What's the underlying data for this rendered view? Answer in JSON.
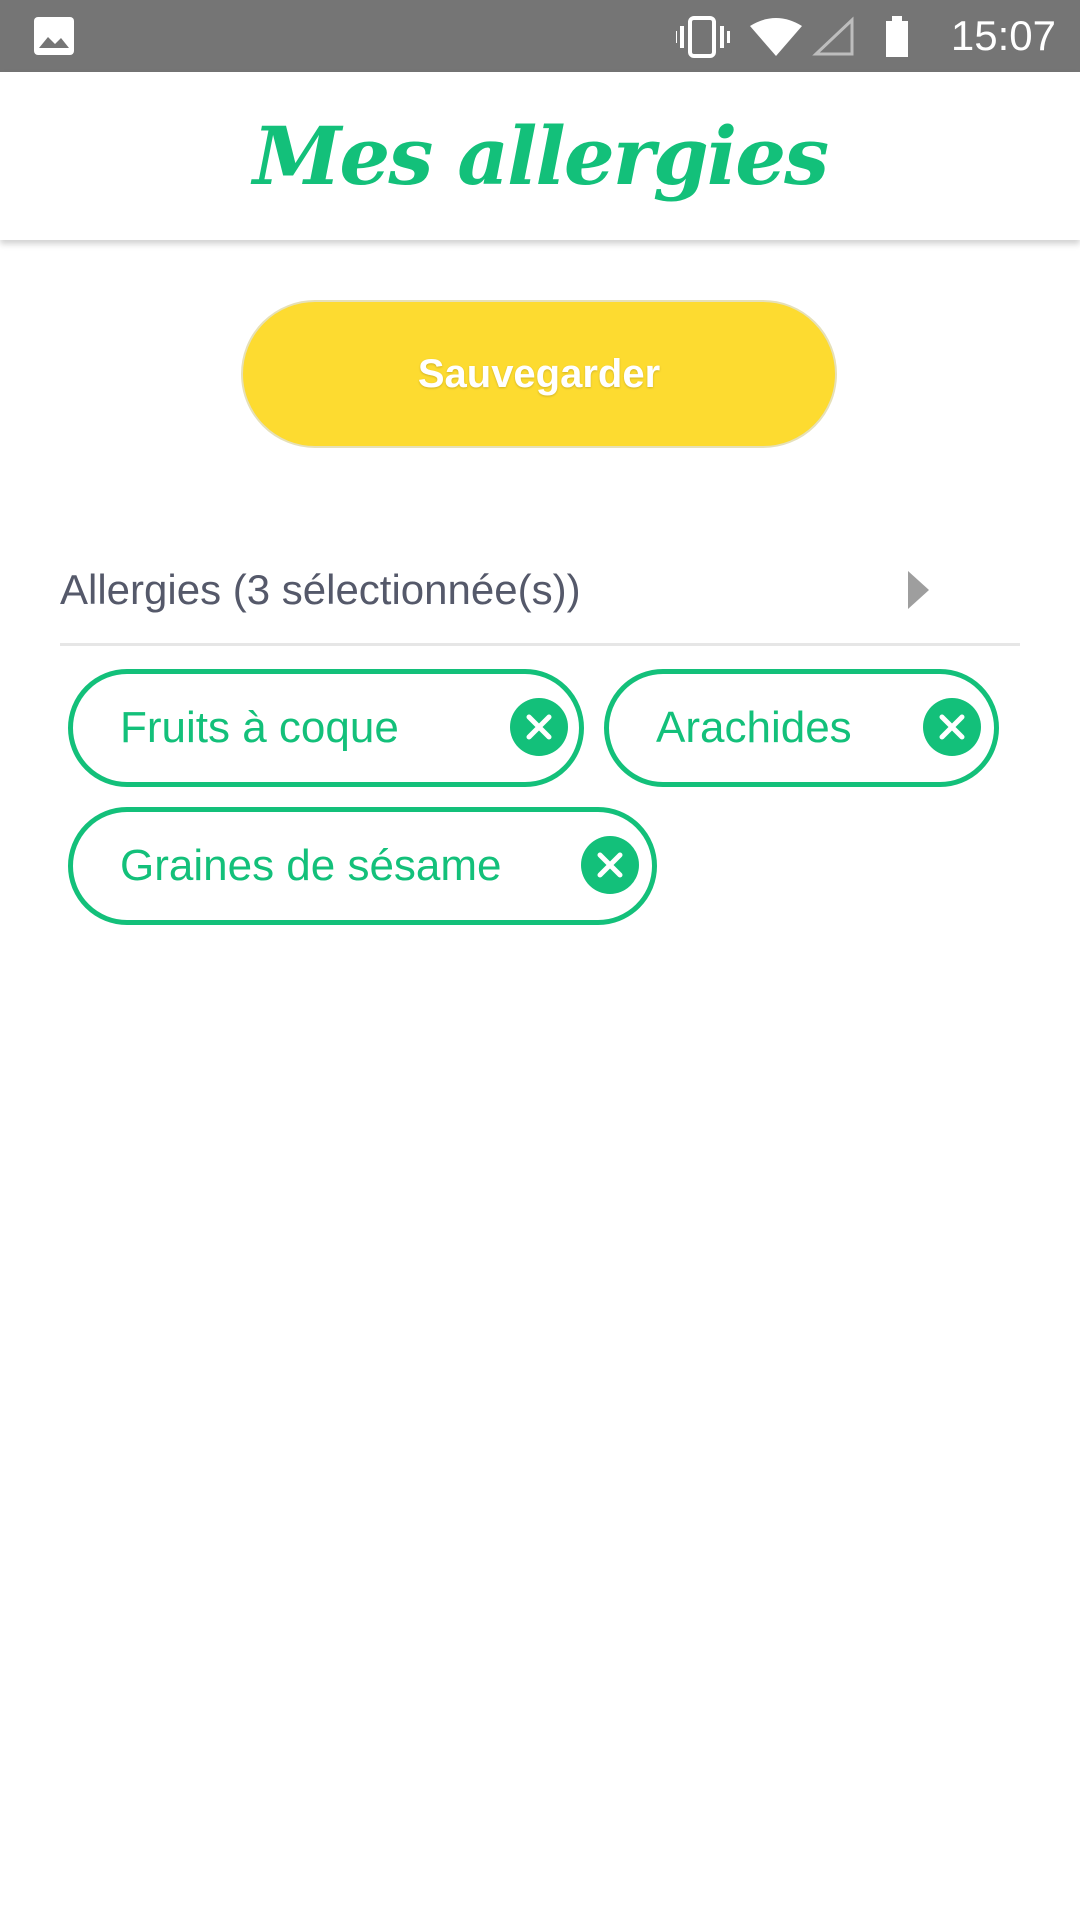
{
  "status_bar": {
    "time": "15:07",
    "icons": [
      "gallery-icon",
      "vibrate-icon",
      "wifi-icon",
      "cell-signal-icon",
      "battery-icon"
    ]
  },
  "app_bar": {
    "title": "Mes allergies"
  },
  "save_button": {
    "label": "Sauvegarder"
  },
  "allergy_selector": {
    "label": "Allergies (3 sélectionnée(s))",
    "icon": "chevron-right-icon"
  },
  "chips": [
    {
      "label": "Fruits à coque"
    },
    {
      "label": "Arachides"
    },
    {
      "label": "Graines de sésame"
    }
  ],
  "colors": {
    "accent_green": "#13c07a",
    "button_yellow": "#fddb30",
    "status_bar_gray": "#757575",
    "label_gray": "#55596a"
  }
}
